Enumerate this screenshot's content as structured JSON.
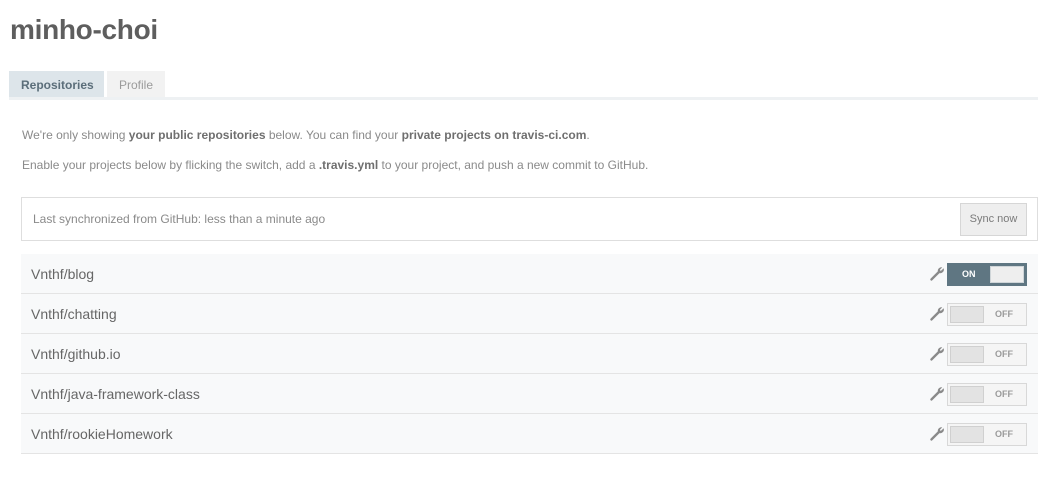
{
  "profile": {
    "username": "minho-choi"
  },
  "tabs": [
    {
      "label": "Repositories",
      "active": true
    },
    {
      "label": "Profile",
      "active": false
    }
  ],
  "info": {
    "line1": {
      "part1": "We're only showing ",
      "bold1": "your public repositories",
      "part2": " below. You can find your ",
      "bold2": "private projects on",
      "part3": " ",
      "bold3": "travis-ci.com",
      "part4": "."
    },
    "line2": {
      "part1": "Enable your projects below by flicking the switch, add a ",
      "bold1": ".travis.yml",
      "part2": " to your project, and push a new commit to GitHub."
    }
  },
  "sync": {
    "status": "Last synchronized from GitHub: less than a minute ago",
    "button_label": "Sync now"
  },
  "repos": [
    {
      "name": "Vnthf/blog",
      "enabled": true,
      "toggle_label": "ON"
    },
    {
      "name": "Vnthf/chatting",
      "enabled": false,
      "toggle_label": "OFF"
    },
    {
      "name": "Vnthf/github.io",
      "enabled": false,
      "toggle_label": "OFF"
    },
    {
      "name": "Vnthf/java-framework-class",
      "enabled": false,
      "toggle_label": "OFF"
    },
    {
      "name": "Vnthf/rookieHomework",
      "enabled": false,
      "toggle_label": "OFF"
    }
  ],
  "icons": {
    "settings": "wrench-icon"
  },
  "colors": {
    "accent": "#5f7682",
    "tab_active_bg": "#dde5ea"
  }
}
